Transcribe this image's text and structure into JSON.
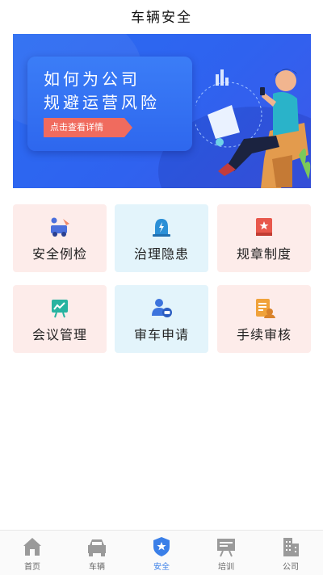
{
  "header": {
    "title": "车辆安全"
  },
  "banner": {
    "line1": "如何为公司",
    "line2": "规避运营风险",
    "cta": "点击查看详情"
  },
  "tiles": [
    {
      "label": "安全例检",
      "icon": "vehicle-inspection-icon",
      "bg": "#fdecea"
    },
    {
      "label": "治理隐患",
      "icon": "warning-light-icon",
      "bg": "#e3f4fb"
    },
    {
      "label": "规章制度",
      "icon": "rulebook-icon",
      "bg": "#fdecea"
    },
    {
      "label": "会议管理",
      "icon": "meeting-chart-icon",
      "bg": "#fdecea"
    },
    {
      "label": "审车申请",
      "icon": "user-car-icon",
      "bg": "#e3f4fb"
    },
    {
      "label": "手续审核",
      "icon": "document-review-icon",
      "bg": "#fdecea"
    }
  ],
  "tabbar": {
    "items": [
      {
        "label": "首页",
        "icon": "home-icon"
      },
      {
        "label": "车辆",
        "icon": "car-icon"
      },
      {
        "label": "安全",
        "icon": "shield-star-icon",
        "active": true
      },
      {
        "label": "培训",
        "icon": "training-board-icon"
      },
      {
        "label": "公司",
        "icon": "building-icon"
      }
    ],
    "active_color": "#3a7fe8"
  }
}
